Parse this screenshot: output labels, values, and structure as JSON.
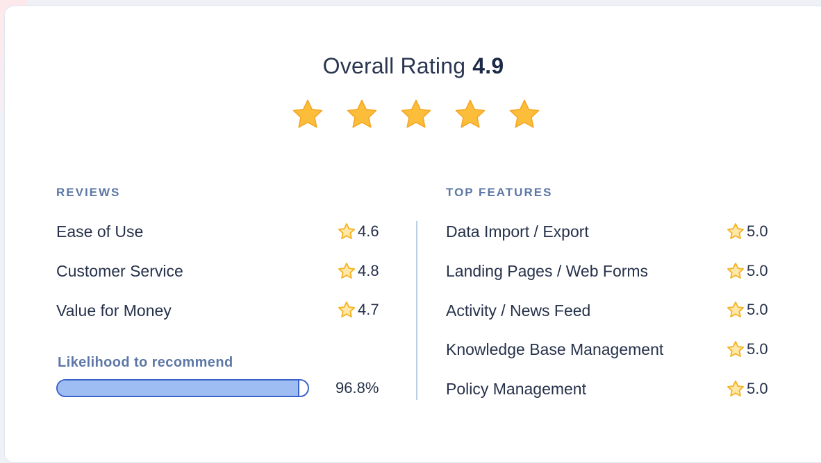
{
  "overall": {
    "label": "Overall Rating",
    "score": "4.9",
    "stars_filled": 5,
    "star_color": "#fbbd3a"
  },
  "reviews": {
    "title": "REVIEWS",
    "items": [
      {
        "label": "Ease of Use",
        "rating": "4.6"
      },
      {
        "label": "Customer Service",
        "rating": "4.8"
      },
      {
        "label": "Value for Money",
        "rating": "4.7"
      }
    ],
    "likelihood": {
      "label": "Likelihood to recommend",
      "value_text": "96.8%",
      "fraction": 0.968
    }
  },
  "top_features": {
    "title": "TOP FEATURES",
    "items": [
      {
        "label": "Data Import / Export",
        "rating": "5.0"
      },
      {
        "label": "Landing Pages / Web Forms",
        "rating": "5.0"
      },
      {
        "label": "Activity / News Feed",
        "rating": "5.0"
      },
      {
        "label": "Knowledge Base Management",
        "rating": "5.0"
      },
      {
        "label": "Policy Management",
        "rating": "5.0"
      }
    ]
  },
  "colors": {
    "accent_blue": "#5c77a6",
    "bar_fill": "#9dbdf3",
    "bar_border": "#3c63c8"
  }
}
